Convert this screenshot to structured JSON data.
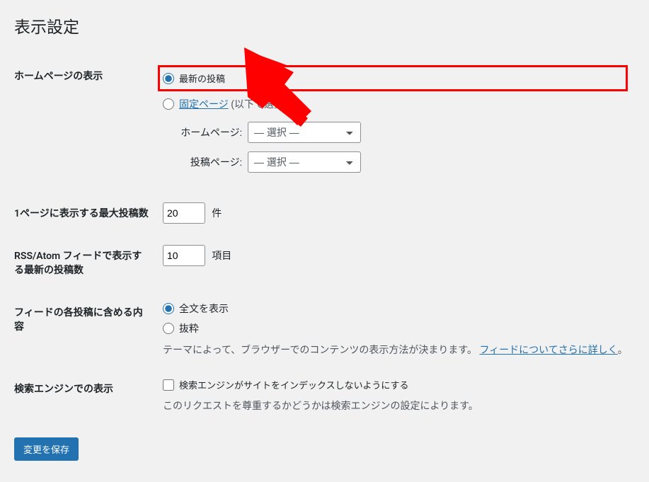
{
  "page_title": "表示設定",
  "rows": {
    "homepage": {
      "label": "ホームページの表示",
      "option_latest": "最新の投稿",
      "option_fixed_link": "固定ページ",
      "option_fixed_suffix": "(以下で選択)",
      "homepage_select_label": "ホームページ:",
      "posts_page_select_label": "投稿ページ:",
      "select_placeholder": "— 選択 —"
    },
    "posts_per_page": {
      "label": "1ページに表示する最大投稿数",
      "value": "20",
      "unit": "件"
    },
    "rss_count": {
      "label": "RSS/Atom フィードで表示する最新の投稿数",
      "value": "10",
      "unit": "項目"
    },
    "feed_content": {
      "label": "フィードの各投稿に含める内容",
      "option_full": "全文を表示",
      "option_excerpt": "抜粋",
      "desc_prefix": "テーマによって、ブラウザーでのコンテンツの表示方法が決まります。",
      "link_text": "フィードについてさらに詳しく",
      "trailing": "。"
    },
    "search_engine": {
      "label": "検索エンジンでの表示",
      "checkbox_label": "検索エンジンがサイトをインデックスしないようにする",
      "desc": "このリクエストを尊重するかどうかは検索エンジンの設定によります。"
    }
  },
  "save_button": "変更を保存"
}
